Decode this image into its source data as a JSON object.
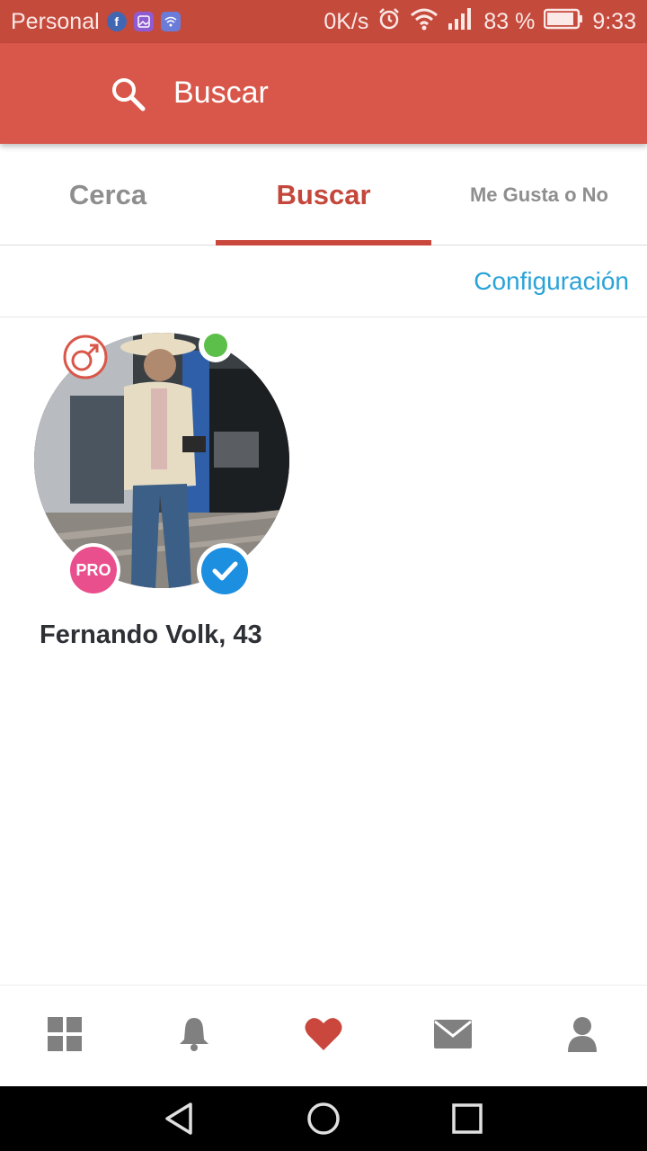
{
  "status_bar": {
    "carrier": "Personal",
    "net_speed": "0K/s",
    "battery": "83 %",
    "time": "9:33",
    "notification_icons": [
      "facebook-icon",
      "gallery-icon",
      "wifi-app-icon"
    ]
  },
  "app_bar": {
    "title": "Buscar",
    "icon": "search-icon",
    "color": "#d9574a"
  },
  "tabs": [
    {
      "label": "Cerca",
      "active": false
    },
    {
      "label": "Buscar",
      "active": true
    },
    {
      "label": "Me Gusta o No",
      "active": false
    }
  ],
  "config_link": "Configuración",
  "profiles": [
    {
      "name_age": "Fernando Volk, 43",
      "badge": "PRO",
      "gender_icon": "male-icon",
      "online": true,
      "verified": true
    }
  ],
  "bottom_nav": [
    {
      "icon": "grid-icon",
      "active": false
    },
    {
      "icon": "bell-icon",
      "active": false
    },
    {
      "icon": "heart-icon",
      "active": true
    },
    {
      "icon": "mail-icon",
      "active": false
    },
    {
      "icon": "person-icon",
      "active": false
    }
  ],
  "colors": {
    "accent": "#c4473b",
    "link": "#2aa3d8",
    "online": "#5cbf4a",
    "pro": "#ea4f8d",
    "verified": "#1c8fe0"
  }
}
